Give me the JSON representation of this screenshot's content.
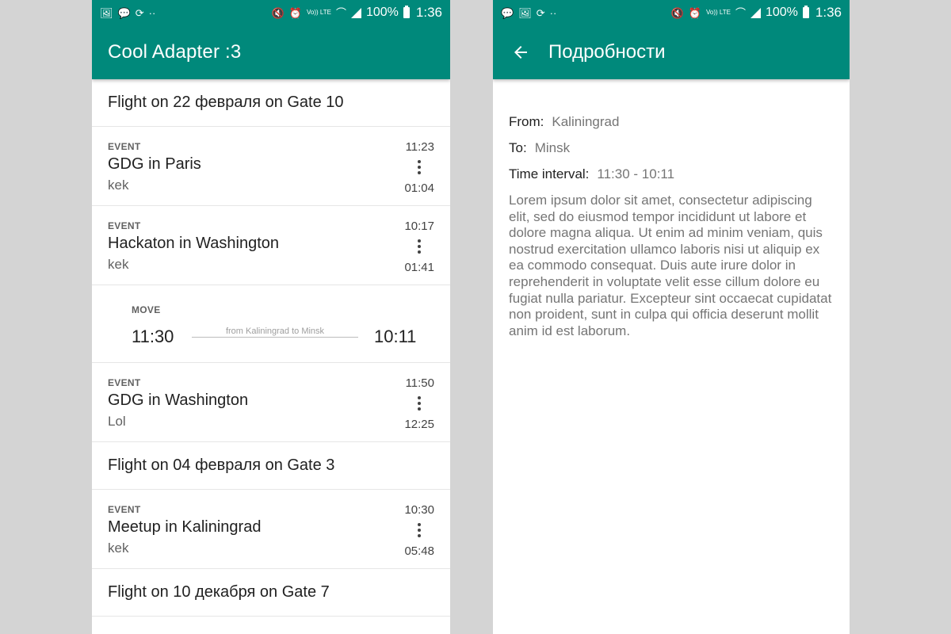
{
  "status_bar": {
    "battery_pct": "100%",
    "time": "1:36",
    "lte_label": "Vo)) LTE",
    "dots": "··"
  },
  "left": {
    "app_title": "Cool Adapter :3",
    "items": [
      {
        "kind": "header",
        "text": "Flight on 22 февраля on Gate 10"
      },
      {
        "kind": "event",
        "type": "EVENT",
        "title": "GDG in Paris",
        "subtitle": "kek",
        "time_top": "11:23",
        "time_bottom": "01:04"
      },
      {
        "kind": "event",
        "type": "EVENT",
        "title": "Hackaton in Washington",
        "subtitle": "kek",
        "time_top": "10:17",
        "time_bottom": "01:41"
      },
      {
        "kind": "move",
        "type": "MOVE",
        "from_time": "11:30",
        "to_time": "10:11",
        "route": "from Kaliningrad to Minsk"
      },
      {
        "kind": "event",
        "type": "EVENT",
        "title": "GDG in Washington",
        "subtitle": "Lol",
        "time_top": "11:50",
        "time_bottom": "12:25"
      },
      {
        "kind": "header",
        "text": "Flight on 04 февраля on Gate 3"
      },
      {
        "kind": "event",
        "type": "EVENT",
        "title": "Meetup in Kaliningrad",
        "subtitle": "kek",
        "time_top": "10:30",
        "time_bottom": "05:48"
      },
      {
        "kind": "header",
        "text": "Flight on 10 декабря on Gate 7"
      }
    ]
  },
  "right": {
    "title": "Подробности",
    "from_label": "From:",
    "from_value": "Kaliningrad",
    "to_label": "To:",
    "to_value": "Minsk",
    "interval_label": "Time interval:",
    "interval_value": "11:30 - 10:11",
    "description": "Lorem ipsum dolor sit amet, consectetur adipiscing elit, sed do eiusmod tempor incididunt ut labore et dolore magna aliqua. Ut enim ad minim veniam, quis nostrud exercitation ullamco laboris nisi ut aliquip ex ea commodo consequat. Duis aute irure dolor in reprehenderit in voluptate velit esse cillum dolore eu fugiat nulla pariatur. Excepteur sint occaecat cupidatat non proident, sunt in culpa qui officia deserunt mollit anim id est laborum."
  },
  "colors": {
    "primary": "#00897b",
    "background": "#d4d4d4"
  },
  "icons": [
    "image-icon",
    "chat-icon",
    "sync-icon",
    "mute-icon",
    "alarm-icon",
    "wifi-icon",
    "signal-icon",
    "battery-icon",
    "back-arrow-icon",
    "more-vert-icon"
  ]
}
